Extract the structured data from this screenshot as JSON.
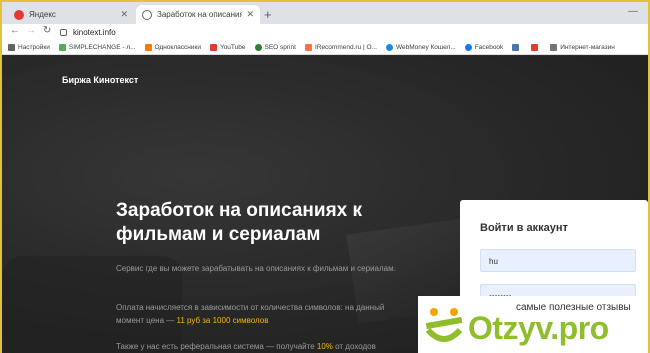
{
  "browser": {
    "tabs": [
      {
        "title": "Яндекс",
        "active": false,
        "favicon_color": "#e53935"
      },
      {
        "title": "Заработок на описаниях к фил",
        "active": true,
        "favicon_color": "#5f6368"
      }
    ],
    "new_tab": "+",
    "minimize": "—",
    "url": "kinotext.info",
    "bookmarks": [
      {
        "label": "Настройки",
        "icon_color": "#5f6368"
      },
      {
        "label": "SIMPLECHANGE - л...",
        "icon_color": "#4caf50"
      },
      {
        "label": "Одноклассники",
        "icon_color": "#f57c00"
      },
      {
        "label": "YouTube",
        "icon_color": "#e53935"
      },
      {
        "label": "SEO sprint",
        "icon_color": "#2e7d32"
      },
      {
        "label": "IRecommend.ru | О...",
        "icon_color": "#ff7043"
      },
      {
        "label": "WebMoney Кошел...",
        "icon_color": "#1e88e5"
      },
      {
        "label": "Facebook",
        "icon_color": "#1877f2"
      },
      {
        "label": "",
        "icon_color": "#4a76a8"
      },
      {
        "label": "",
        "icon_color": "#e53935"
      },
      {
        "label": "Интернет-магазин",
        "icon_color": "#757575"
      }
    ]
  },
  "page": {
    "brand": "Биржа Кинотекст",
    "headline": "Заработок на описаниях к фильмам и сериалам",
    "desc1": "Сервис где вы можете зарабатывать на описаниях к фильмам и сериалам.",
    "desc2_pre": "Оплата начисляется в зависимости от количества символов: на данный момент цена — ",
    "desc2_hl": "11 руб за 1000 символов",
    "desc3_pre": "Также у нас есть реферальная система — получайте ",
    "desc3_hl": "10%",
    "desc3_post": " от доходов",
    "accent_color": "#f4b400"
  },
  "login": {
    "title": "Войти в аккаунт",
    "username_value": "hu",
    "password_value": "••••••••"
  },
  "watermark": {
    "subtitle": "самые полезные отзывы",
    "text": "Otzyv.pro"
  }
}
